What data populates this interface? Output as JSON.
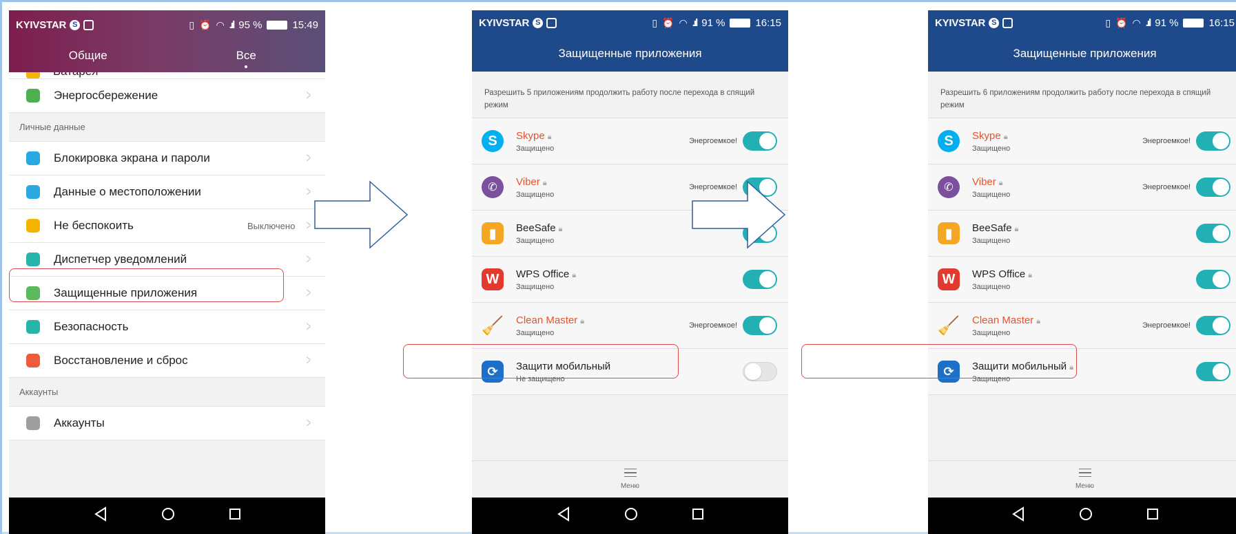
{
  "colors": {
    "accent_teal": "#22b0b5",
    "header_blue": "#1e4a8c",
    "highlight_red": "#e24b4b",
    "warning_orange": "#e2532d"
  },
  "screen1": {
    "status": {
      "carrier": "KYIVSTAR",
      "battery": "95 %",
      "time": "15:49"
    },
    "tabs": {
      "general": "Общие",
      "all": "Все"
    },
    "partial_item": "Батарея",
    "items_top": [
      {
        "label": "Энергосбережение",
        "icon": "battery-icon",
        "color": "#4caf50"
      }
    ],
    "section_personal": "Личные данные",
    "items_personal": [
      {
        "label": "Блокировка экрана и пароли",
        "icon": "lock-icon",
        "color": "#29a9e0",
        "value": ""
      },
      {
        "label": "Данные о местоположении",
        "icon": "location-icon",
        "color": "#29a9e0",
        "value": ""
      },
      {
        "label": "Не беспокоить",
        "icon": "moon-icon",
        "color": "#f4b400",
        "value": "Выключено"
      },
      {
        "label": "Диспетчер уведомлений",
        "icon": "notification-icon",
        "color": "#26b5a8",
        "value": ""
      },
      {
        "label": "Защищенные приложения",
        "icon": "protected-apps-icon",
        "color": "#5cb85c",
        "value": ""
      },
      {
        "label": "Безопасность",
        "icon": "shield-icon",
        "color": "#26b5a8",
        "value": ""
      },
      {
        "label": "Восстановление и сброс",
        "icon": "reset-icon",
        "color": "#ef5a3c",
        "value": ""
      }
    ],
    "section_accounts": "Аккаунты",
    "items_accounts": [
      {
        "label": "Аккаунты",
        "icon": "user-icon",
        "color": "#9e9e9e",
        "value": ""
      }
    ]
  },
  "screen2": {
    "status": {
      "carrier": "KYIVSTAR",
      "battery": "91 %",
      "time": "16:15"
    },
    "title": "Защищенные приложения",
    "description": "Разрешить 5 приложениям продолжить работу после перехода в спящий режим",
    "apps": [
      {
        "name": "Skype",
        "status": "Защищено",
        "energy": "Энергоемкое!",
        "warn": true,
        "on": true,
        "icon": "skype-icon",
        "letter": "S",
        "color": "#00aff0"
      },
      {
        "name": "Viber",
        "status": "Защищено",
        "energy": "Энергоемкое!",
        "warn": true,
        "on": true,
        "icon": "viber-icon",
        "letter": "✆",
        "color": "#7b519d"
      },
      {
        "name": "BeeSafe",
        "status": "Защищено",
        "energy": "",
        "warn": false,
        "on": true,
        "icon": "beesafe-icon",
        "letter": "▮",
        "color": "#f5a623"
      },
      {
        "name": "WPS Office",
        "status": "Защищено",
        "energy": "",
        "warn": false,
        "on": true,
        "icon": "wps-office-icon",
        "letter": "W",
        "color": "#e23a2e"
      },
      {
        "name": "Clean Master",
        "status": "Защищено",
        "energy": "Энергоемкое!",
        "warn": true,
        "on": true,
        "icon": "clean-master-icon",
        "letter": "🧹",
        "color": "transparent"
      },
      {
        "name": "Защити мобильный",
        "status": "Не защищено",
        "energy": "",
        "warn": false,
        "on": false,
        "icon": "zashchiti-mobilnyi-icon",
        "letter": "⟳",
        "color": "#1e6fc8"
      }
    ],
    "menu_label": "Меню"
  },
  "screen3": {
    "status": {
      "carrier": "KYIVSTAR",
      "battery": "91 %",
      "time": "16:15"
    },
    "title": "Защищенные приложения",
    "description": "Разрешить 6 приложениям продолжить работу после перехода в спящий режим",
    "apps": [
      {
        "name": "Skype",
        "status": "Защищено",
        "energy": "Энергоемкое!",
        "warn": true,
        "on": true,
        "icon": "skype-icon",
        "letter": "S",
        "color": "#00aff0"
      },
      {
        "name": "Viber",
        "status": "Защищено",
        "energy": "Энергоемкое!",
        "warn": true,
        "on": true,
        "icon": "viber-icon",
        "letter": "✆",
        "color": "#7b519d"
      },
      {
        "name": "BeeSafe",
        "status": "Защищено",
        "energy": "",
        "warn": false,
        "on": true,
        "icon": "beesafe-icon",
        "letter": "▮",
        "color": "#f5a623"
      },
      {
        "name": "WPS Office",
        "status": "Защищено",
        "energy": "",
        "warn": false,
        "on": true,
        "icon": "wps-office-icon",
        "letter": "W",
        "color": "#e23a2e"
      },
      {
        "name": "Clean Master",
        "status": "Защищено",
        "energy": "Энергоемкое!",
        "warn": true,
        "on": true,
        "icon": "clean-master-icon",
        "letter": "🧹",
        "color": "transparent"
      },
      {
        "name": "Защити мобильный",
        "status": "Защищено",
        "energy": "",
        "warn": false,
        "on": true,
        "icon": "zashchiti-mobilnyi-icon",
        "letter": "⟳",
        "color": "#1e6fc8"
      }
    ],
    "menu_label": "Меню"
  }
}
